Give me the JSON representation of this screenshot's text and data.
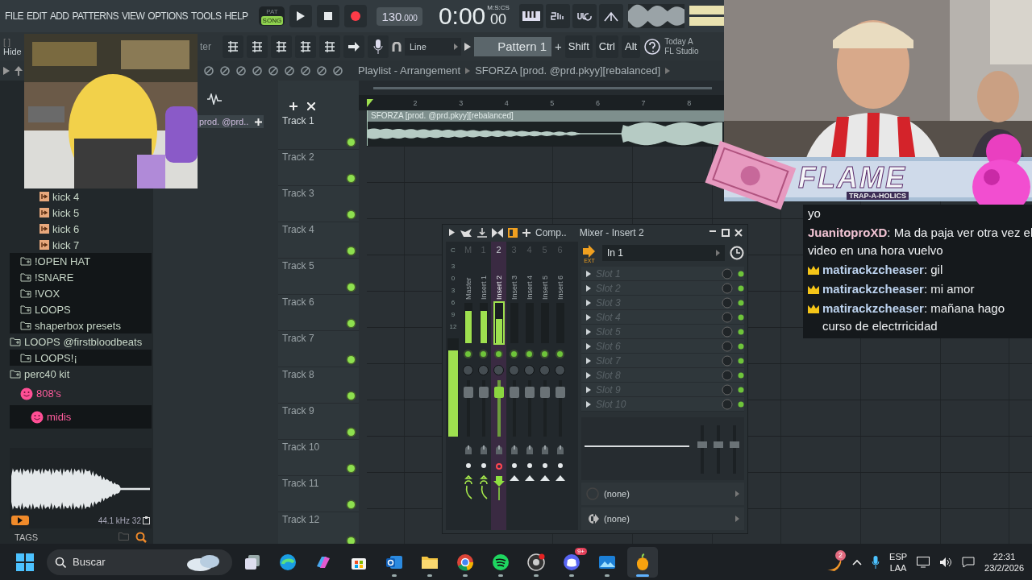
{
  "menu": [
    "FILE",
    "EDIT",
    "ADD",
    "PATTERNS",
    "VIEW",
    "OPTIONS",
    "TOOLS",
    "HELP"
  ],
  "transport": {
    "pat": "PAT",
    "song": "SONG",
    "song_mode": true,
    "tempo": "130",
    "tempo_fraction": ".000",
    "time": "0:00",
    "time_cs": "00",
    "time_label": "M:S:CS"
  },
  "toolbar": {
    "hide": "Hide",
    "hide_bracket": "[ ]",
    "cut_label": "ter",
    "snap": "Line",
    "pattern": "Pattern 1",
    "plus": "+",
    "keys": [
      "Shift",
      "Ctrl",
      "Alt"
    ],
    "news_1": "Today A",
    "news_2": "FL Studio"
  },
  "channel_rack": {
    "pattern_label": "prod. @prd.."
  },
  "playlist": {
    "title": "Playlist - Arrangement",
    "song": "SFORZA [prod. @prd.pkyy][rebalanced]",
    "ruler": [
      "2",
      "3",
      "4",
      "5",
      "6",
      "7",
      "8"
    ],
    "clip": {
      "label": "SFORZA [prod. @prd.pkyy][rebalanced]"
    },
    "tracks": [
      {
        "name": "Track 1"
      },
      {
        "name": "Track 2"
      },
      {
        "name": "Track 3"
      },
      {
        "name": "Track 4"
      },
      {
        "name": "Track 5"
      },
      {
        "name": "Track 6"
      },
      {
        "name": "Track 7"
      },
      {
        "name": "Track 8"
      },
      {
        "name": "Track 9"
      },
      {
        "name": "Track 10"
      },
      {
        "name": "Track 11"
      },
      {
        "name": "Track 12"
      }
    ]
  },
  "browser": {
    "tree": [
      {
        "children": [
          {
            "children": [
              {
                "kind": "file",
                "label": "kick 4"
              },
              {
                "kind": "file",
                "label": "kick 5"
              },
              {
                "kind": "file",
                "label": "kick 6"
              },
              {
                "kind": "file",
                "label": "kick 7"
              }
            ]
          },
          {
            "kind": "folder",
            "label": "!OPEN HAT"
          },
          {
            "kind": "folder",
            "label": "!SNARE"
          },
          {
            "kind": "folder",
            "label": "!VOX"
          },
          {
            "kind": "folder",
            "label": "LOOPS"
          },
          {
            "kind": "folder",
            "label": "shaperbox presets"
          }
        ]
      },
      {
        "kind": "folder",
        "label": "LOOPS @firstbloodbeats",
        "children": [
          {
            "kind": "folder",
            "label": "LOOPS!¡"
          }
        ]
      },
      {
        "kind": "folder",
        "label": "perc40 kit",
        "children": [
          {
            "kind": "smiley",
            "label": "808's",
            "children": [
              {
                "kind": "smiley",
                "label": "midis"
              }
            ]
          }
        ]
      }
    ],
    "sample_rate": "44.1 kHz 32",
    "tags": "TAGS"
  },
  "mixer": {
    "tool_label": "Comp..",
    "title": "Mixer - Insert 2",
    "scale_header": "C",
    "scale": [
      "3",
      "0",
      "3",
      "6",
      "9",
      "12"
    ],
    "master_meter": {
      "level": 0.88
    },
    "strips": [
      {
        "number": "M",
        "name": "Master",
        "selected": false,
        "armed": false,
        "level": 0.8,
        "kind": "curve"
      },
      {
        "number": "1",
        "name": "Insert 1",
        "selected": false,
        "armed": false,
        "level": 0.8,
        "kind": "curve"
      },
      {
        "number": "2",
        "name": "Insert 2",
        "selected": true,
        "armed": true,
        "level": 0.6,
        "kind": "down"
      },
      {
        "number": "3",
        "name": "Insert 3",
        "selected": false,
        "armed": false,
        "level": 0,
        "kind": "up"
      },
      {
        "number": "4",
        "name": "Insert 4",
        "selected": false,
        "armed": false,
        "level": 0,
        "kind": "up"
      },
      {
        "number": "5",
        "name": "Insert 5",
        "selected": false,
        "armed": false,
        "level": 0,
        "kind": "up"
      },
      {
        "number": "6",
        "name": "Insert 6",
        "selected": false,
        "armed": false,
        "level": 0,
        "kind": "up"
      }
    ],
    "input": "In 1",
    "input_badge": "EXT",
    "slots": [
      "Slot 1",
      "Slot 2",
      "Slot 3",
      "Slot 4",
      "Slot 5",
      "Slot 6",
      "Slot 7",
      "Slot 8",
      "Slot 9",
      "Slot 10"
    ],
    "outputs": [
      "(none)",
      "(none)"
    ]
  },
  "banner": {
    "title": "FLAME",
    "subtitle": "TRAP-A-HOLICS"
  },
  "chat": [
    {
      "text": "yo"
    },
    {
      "user": "JuanitoproXD",
      "color": "#f2c4d4",
      "badge": false,
      "text": ": Ma da paja ver otra vez el video en una hora vuelvo"
    },
    {
      "user": "matirackzcheaser",
      "color": "#bcd2ee",
      "badge": true,
      "text": ": gil"
    },
    {
      "user": "matirackzcheaser",
      "color": "#bcd2ee",
      "badge": true,
      "text": ": mi amor"
    },
    {
      "user": "matirackzcheaser",
      "color": "#bcd2ee",
      "badge": true,
      "text": ": mañana hago curso de electrricidad"
    }
  ],
  "taskbar": {
    "search": "Buscar",
    "apps": [
      {
        "kind": "taskview",
        "running": false,
        "selected": false
      },
      {
        "kind": "edge",
        "running": false,
        "selected": false
      },
      {
        "kind": "copilot",
        "running": false,
        "selected": false
      },
      {
        "kind": "store",
        "running": false,
        "selected": false
      },
      {
        "kind": "outlook",
        "running": true,
        "selected": false
      },
      {
        "kind": "folder",
        "running": true,
        "selected": false
      },
      {
        "kind": "chrome",
        "running": true,
        "selected": false
      },
      {
        "kind": "spotify",
        "running": true,
        "selected": false
      },
      {
        "kind": "obs",
        "running": true,
        "selected": false
      },
      {
        "kind": "discord",
        "running": true,
        "selected": false,
        "badge": "9+"
      },
      {
        "kind": "photos",
        "running": true,
        "selected": false
      },
      {
        "kind": "fl",
        "running": true,
        "selected": true
      }
    ],
    "notification_badge": "2",
    "lang_1": "ESP",
    "lang_2": "LAA",
    "time": "22:31",
    "date": "23/2/2026"
  }
}
